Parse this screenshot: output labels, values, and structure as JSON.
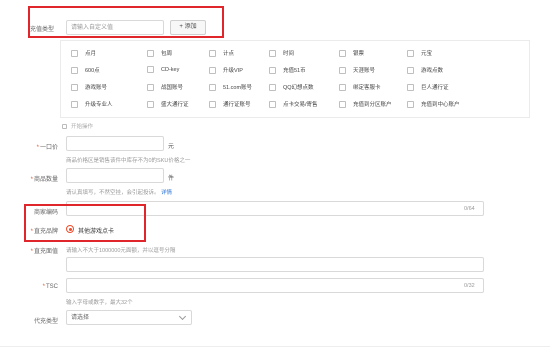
{
  "recharge_type": {
    "label": "充值类型",
    "input_placeholder": "请输入自定义值",
    "add_button": "+ 添加"
  },
  "options": [
    [
      "点月",
      "包周",
      "计点",
      "时间",
      "银票",
      "元宝"
    ],
    [
      "600点",
      "CD-key",
      "升级VIP",
      "充值51币",
      "天涯账号",
      "游戏点数"
    ],
    [
      "游戏账号",
      "战国账号",
      "51.com账号",
      "QQ幻想点数",
      "绑定客服卡",
      "巨人通行证"
    ],
    [
      "升级专业人",
      "盛大通行证",
      "通行证账号",
      "点卡交易/寄售",
      "充值到分区账户",
      "充值到中心账户"
    ]
  ],
  "batch_action": "开始操作",
  "price": {
    "label": "一口价",
    "unit": "元",
    "hint": "商品价格区是销售该件中库存不为0的SKU价格之一"
  },
  "quantity": {
    "label": "商品数量",
    "unit": "件",
    "hint": "请认真填写，不然空挂，会引起投诉。",
    "hint_link": "详情"
  },
  "merchant_code": {
    "label": "商家编码",
    "counter": "0/64"
  },
  "recharge_mode": {
    "label": "直充品牌",
    "option": "其他游戏点卡"
  },
  "recharge_amount": {
    "label": "直充面值",
    "hint": "请输入不大于1000000元面额，并以逗号分隔"
  },
  "tsc": {
    "label": "TSC",
    "counter": "0/32",
    "hint": "输入字母或数字，最大32个"
  },
  "agent_type": {
    "label": "代充类型",
    "select_value": "请选择"
  },
  "colors": {
    "highlight": "#e0262a",
    "accent": "#ee4d2d",
    "link": "#2a74d6"
  }
}
